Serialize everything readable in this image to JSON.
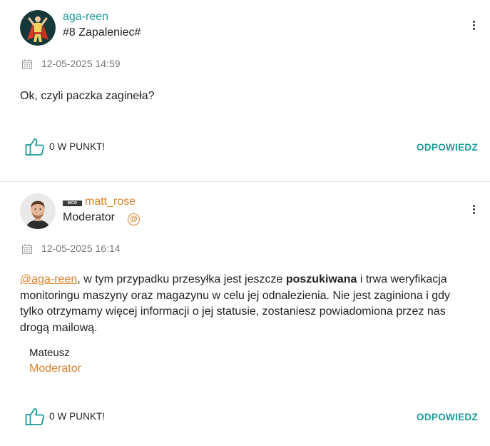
{
  "colors": {
    "accent": "#1c9a9a",
    "orange": "#d9822b",
    "divider": "#e2e2e2"
  },
  "posts": [
    {
      "username": "aga-reen",
      "rank": "#8 Zapaleniec#",
      "date": "12-05-2025 14:59",
      "body": "Ok, czyli paczka zagineła?",
      "kudos_label": "0 W PUNKT!",
      "reply_label": "ODPOWIEDZ",
      "icons": {
        "avatar": "superhero-avatar-icon",
        "menu": "kebab-menu-icon",
        "date": "calendar-icon",
        "like": "thumbs-up-icon"
      }
    },
    {
      "username": "matt_rose",
      "badge": "MOD",
      "rank": "Moderator",
      "date": "12-05-2025 16:14",
      "mention": "@aga-reen",
      "body_part1": ", w tym przypadku przesyłka jest jeszcze ",
      "body_bold": "poszukiwana",
      "body_part2": " i trwa weryfikacja",
      "body_line2": "monitoringu maszyny oraz magazynu w celu jej odnalezienia. Nie jest zaginiona i gdy",
      "body_line3": "tylko otrzymamy więcej informacji o jej statusie, zostaniesz powiadomiona przez nas",
      "body_line4": "drogą mailową.",
      "signature_name": "Mateusz",
      "signature_role": "Moderator",
      "kudos_label": "0 W PUNKT!",
      "reply_label": "ODPOWIEDZ",
      "icons": {
        "avatar": "user-photo-avatar",
        "menu": "kebab-menu-icon",
        "date": "calendar-icon",
        "like": "thumbs-up-icon",
        "mod_at": "at-sign-icon"
      }
    }
  ]
}
